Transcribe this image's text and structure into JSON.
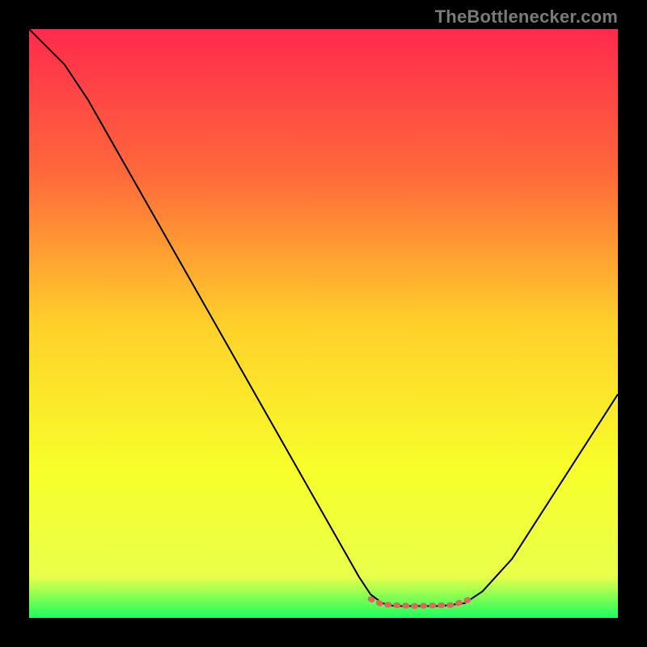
{
  "source_label": "TheBottlenecker.com",
  "chart_data": {
    "type": "line",
    "title": "",
    "xlabel": "",
    "ylabel": "",
    "xlim": [
      0,
      100
    ],
    "ylim": [
      0,
      100
    ],
    "gradient_stops": [
      {
        "offset": 0,
        "color": "#ff2a4d"
      },
      {
        "offset": 25,
        "color": "#ff6a3a"
      },
      {
        "offset": 50,
        "color": "#ffd02a"
      },
      {
        "offset": 75,
        "color": "#f7ff2a"
      },
      {
        "offset": 93,
        "color": "#e8ff4a"
      },
      {
        "offset": 100,
        "color": "#1aff5e"
      }
    ],
    "series": [
      {
        "name": "bottleneck-curve",
        "color": "#000000",
        "width": 2.0,
        "points": [
          {
            "x": 0,
            "y": 100
          },
          {
            "x": 6,
            "y": 94
          },
          {
            "x": 10,
            "y": 88
          },
          {
            "x": 56,
            "y": 7
          },
          {
            "x": 58,
            "y": 4
          },
          {
            "x": 60,
            "y": 2.5
          },
          {
            "x": 62,
            "y": 2
          },
          {
            "x": 70,
            "y": 2
          },
          {
            "x": 74,
            "y": 2.5
          },
          {
            "x": 77,
            "y": 4.5
          },
          {
            "x": 82,
            "y": 10
          },
          {
            "x": 100,
            "y": 38
          }
        ]
      },
      {
        "name": "optimal-band",
        "color": "#d86a5f",
        "width": 7,
        "dash": [
          2,
          9
        ],
        "points": [
          {
            "x": 58,
            "y": 3.2
          },
          {
            "x": 60,
            "y": 2.3
          },
          {
            "x": 65,
            "y": 2
          },
          {
            "x": 72,
            "y": 2.2
          },
          {
            "x": 75,
            "y": 3.2
          }
        ]
      }
    ]
  }
}
